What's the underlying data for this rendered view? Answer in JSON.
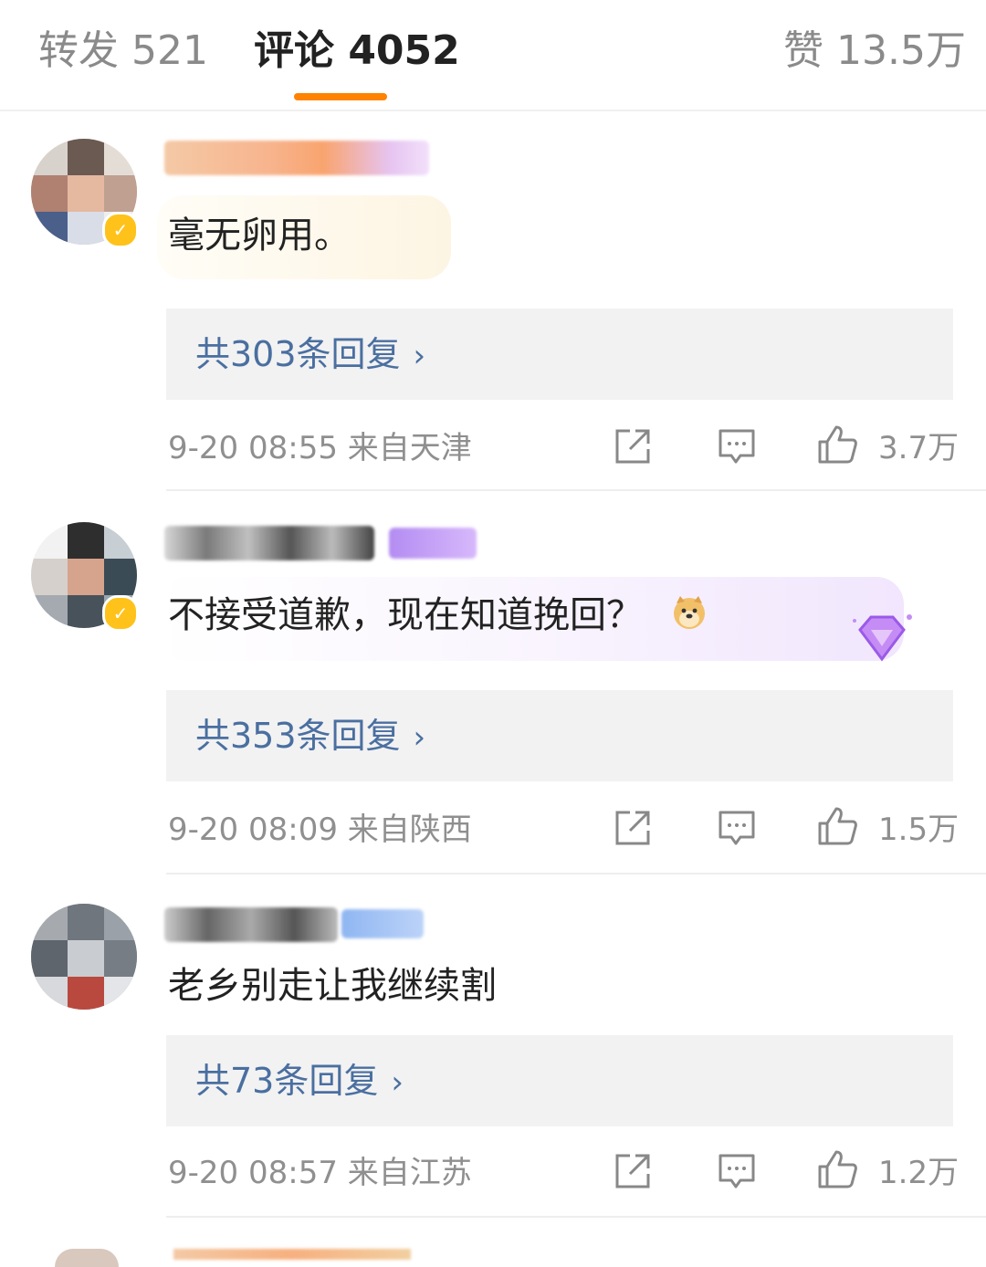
{
  "tabs": [
    {
      "label": "转发 521"
    },
    {
      "label": "评论 4052"
    },
    {
      "label": "赞 13.5万"
    }
  ],
  "colors": {
    "accent": "#ff8200",
    "reply_link": "#4a6fa0",
    "meta": "#8f8f8f"
  },
  "comments": [
    {
      "text": "毫无卵用。",
      "replies": "共303条回复",
      "time": "9-20 08:55",
      "location": "来自天津",
      "likes": "3.7万"
    },
    {
      "text": "不接受道歉，现在知道挽回？",
      "emoji": "doge-emoji",
      "replies": "共353条回复",
      "time": "9-20 08:09",
      "location": "来自陕西",
      "likes": "1.5万"
    },
    {
      "text": "老乡别走让我继续割",
      "replies": "共73条回复",
      "time": "9-20 08:57",
      "location": "来自江苏",
      "likes": "1.2万"
    }
  ]
}
